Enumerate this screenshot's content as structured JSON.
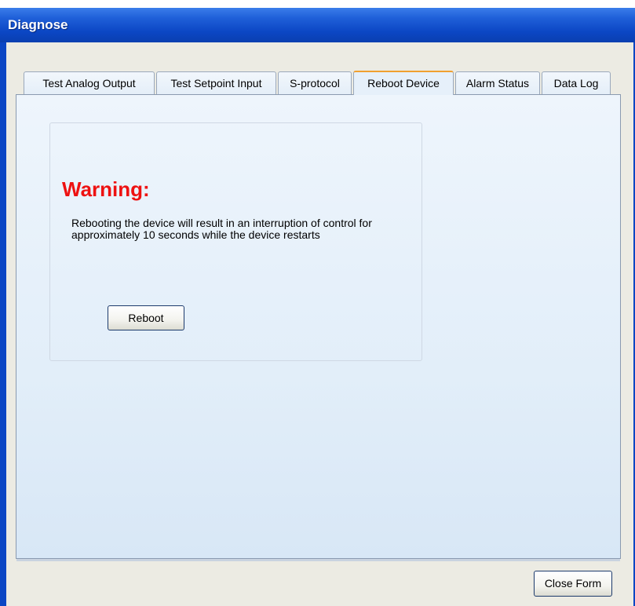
{
  "window": {
    "title": "Diagnose"
  },
  "tabs": [
    {
      "label": "Test Analog Output",
      "active": false
    },
    {
      "label": "Test Setpoint Input",
      "active": false
    },
    {
      "label": "S-protocol",
      "active": false
    },
    {
      "label": "Reboot Device",
      "active": true
    },
    {
      "label": "Alarm Status",
      "active": false
    },
    {
      "label": "Data Log",
      "active": false
    }
  ],
  "reboot_panel": {
    "warning_title": "Warning:",
    "warning_text": "Rebooting the device will result in an interruption of control for approximately 10 seconds while the device restarts",
    "reboot_button": "Reboot"
  },
  "footer": {
    "close_button": "Close Form"
  },
  "colors": {
    "titlebar": "#0b46c4",
    "warning": "#ee1111",
    "active_tab_accent": "#f0a030"
  }
}
